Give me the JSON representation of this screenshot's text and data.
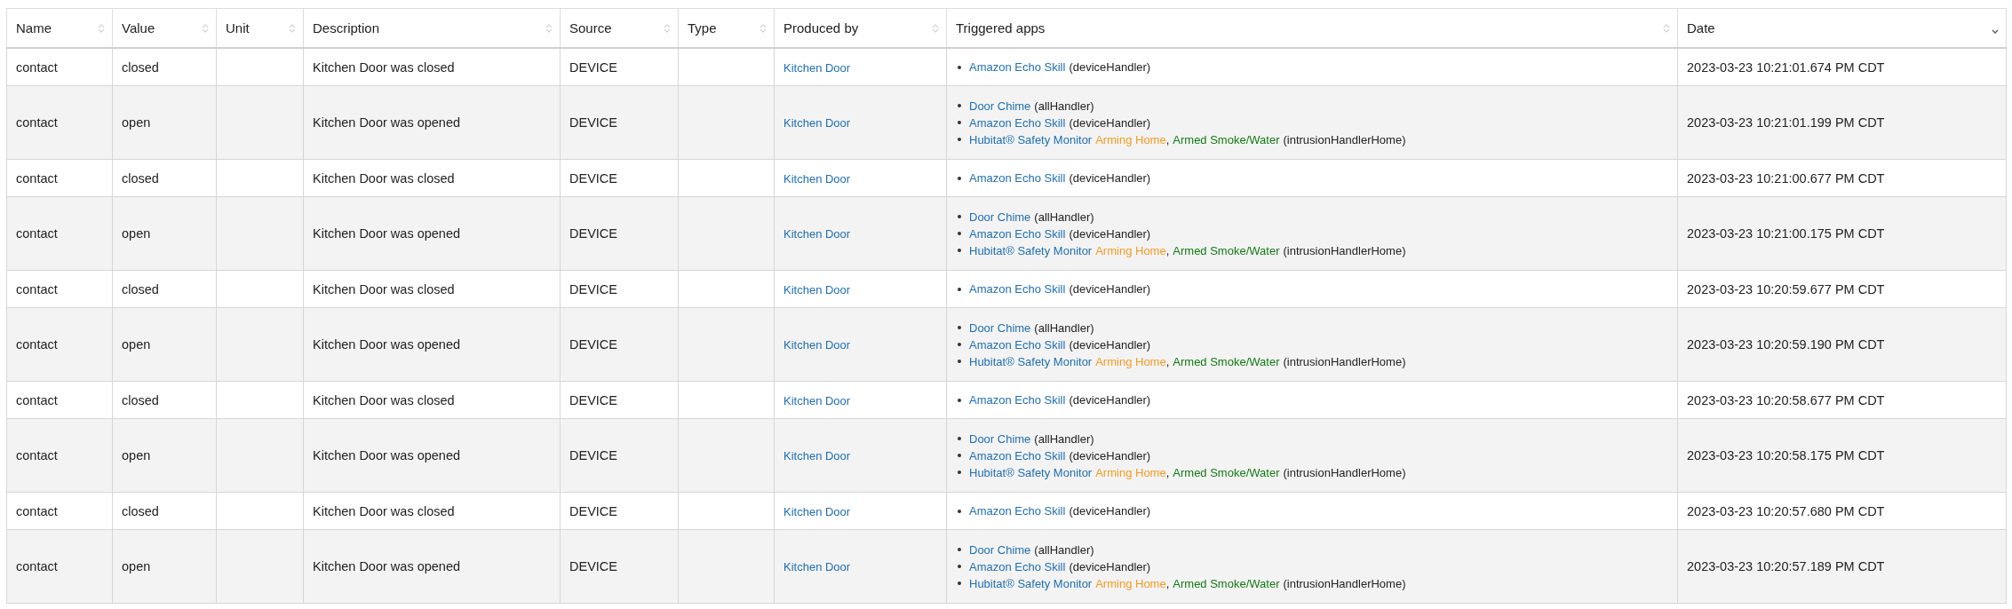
{
  "table": {
    "columns": [
      {
        "label": "Name",
        "sorted": false
      },
      {
        "label": "Value",
        "sorted": false
      },
      {
        "label": "Unit",
        "sorted": false
      },
      {
        "label": "Description",
        "sorted": false
      },
      {
        "label": "Source",
        "sorted": false
      },
      {
        "label": "Type",
        "sorted": false
      },
      {
        "label": "Produced by",
        "sorted": false
      },
      {
        "label": "Triggered apps",
        "sorted": false
      },
      {
        "label": "Date",
        "sorted": true
      }
    ],
    "rows": [
      {
        "name": "contact",
        "value": "closed",
        "description": "Kitchen Door was closed",
        "source": "DEVICE",
        "produced_by": "Kitchen Door",
        "triggered_apps": [
          [
            {
              "kind": "link",
              "text": "Amazon Echo Skill"
            },
            {
              "kind": "plain",
              "text": "(deviceHandler)"
            }
          ]
        ],
        "date": "2023-03-23 10:21:01.674 PM CDT"
      },
      {
        "name": "contact",
        "value": "open",
        "description": "Kitchen Door was opened",
        "source": "DEVICE",
        "produced_by": "Kitchen Door",
        "triggered_apps": [
          [
            {
              "kind": "link",
              "text": "Door Chime"
            },
            {
              "kind": "plain",
              "text": "(allHandler)"
            }
          ],
          [
            {
              "kind": "link",
              "text": "Amazon Echo Skill"
            },
            {
              "kind": "plain",
              "text": "(deviceHandler)"
            }
          ],
          [
            {
              "kind": "link",
              "text": "Hubitat® Safety Monitor"
            },
            {
              "kind": "mode",
              "text": "Arming Home",
              "color": "#f59b22"
            },
            {
              "kind": "sep",
              "text": ","
            },
            {
              "kind": "mode",
              "text": "Armed Smoke/Water",
              "color": "#137a13"
            },
            {
              "kind": "plain",
              "text": "(intrusionHandlerHome)"
            }
          ]
        ],
        "date": "2023-03-23 10:21:01.199 PM CDT"
      },
      {
        "name": "contact",
        "value": "closed",
        "description": "Kitchen Door was closed",
        "source": "DEVICE",
        "produced_by": "Kitchen Door",
        "triggered_apps": [
          [
            {
              "kind": "link",
              "text": "Amazon Echo Skill"
            },
            {
              "kind": "plain",
              "text": "(deviceHandler)"
            }
          ]
        ],
        "date": "2023-03-23 10:21:00.677 PM CDT"
      },
      {
        "name": "contact",
        "value": "open",
        "description": "Kitchen Door was opened",
        "source": "DEVICE",
        "produced_by": "Kitchen Door",
        "triggered_apps": [
          [
            {
              "kind": "link",
              "text": "Door Chime"
            },
            {
              "kind": "plain",
              "text": "(allHandler)"
            }
          ],
          [
            {
              "kind": "link",
              "text": "Amazon Echo Skill"
            },
            {
              "kind": "plain",
              "text": "(deviceHandler)"
            }
          ],
          [
            {
              "kind": "link",
              "text": "Hubitat® Safety Monitor"
            },
            {
              "kind": "mode",
              "text": "Arming Home",
              "color": "#f59b22"
            },
            {
              "kind": "sep",
              "text": ","
            },
            {
              "kind": "mode",
              "text": "Armed Smoke/Water",
              "color": "#137a13"
            },
            {
              "kind": "plain",
              "text": "(intrusionHandlerHome)"
            }
          ]
        ],
        "date": "2023-03-23 10:21:00.175 PM CDT"
      },
      {
        "name": "contact",
        "value": "closed",
        "description": "Kitchen Door was closed",
        "source": "DEVICE",
        "produced_by": "Kitchen Door",
        "triggered_apps": [
          [
            {
              "kind": "link",
              "text": "Amazon Echo Skill"
            },
            {
              "kind": "plain",
              "text": "(deviceHandler)"
            }
          ]
        ],
        "date": "2023-03-23 10:20:59.677 PM CDT"
      },
      {
        "name": "contact",
        "value": "open",
        "description": "Kitchen Door was opened",
        "source": "DEVICE",
        "produced_by": "Kitchen Door",
        "triggered_apps": [
          [
            {
              "kind": "link",
              "text": "Door Chime"
            },
            {
              "kind": "plain",
              "text": "(allHandler)"
            }
          ],
          [
            {
              "kind": "link",
              "text": "Amazon Echo Skill"
            },
            {
              "kind": "plain",
              "text": "(deviceHandler)"
            }
          ],
          [
            {
              "kind": "link",
              "text": "Hubitat® Safety Monitor"
            },
            {
              "kind": "mode",
              "text": "Arming Home",
              "color": "#f59b22"
            },
            {
              "kind": "sep",
              "text": ","
            },
            {
              "kind": "mode",
              "text": "Armed Smoke/Water",
              "color": "#137a13"
            },
            {
              "kind": "plain",
              "text": "(intrusionHandlerHome)"
            }
          ]
        ],
        "date": "2023-03-23 10:20:59.190 PM CDT"
      },
      {
        "name": "contact",
        "value": "closed",
        "description": "Kitchen Door was closed",
        "source": "DEVICE",
        "produced_by": "Kitchen Door",
        "triggered_apps": [
          [
            {
              "kind": "link",
              "text": "Amazon Echo Skill"
            },
            {
              "kind": "plain",
              "text": "(deviceHandler)"
            }
          ]
        ],
        "date": "2023-03-23 10:20:58.677 PM CDT"
      },
      {
        "name": "contact",
        "value": "open",
        "description": "Kitchen Door was opened",
        "source": "DEVICE",
        "produced_by": "Kitchen Door",
        "triggered_apps": [
          [
            {
              "kind": "link",
              "text": "Door Chime"
            },
            {
              "kind": "plain",
              "text": "(allHandler)"
            }
          ],
          [
            {
              "kind": "link",
              "text": "Amazon Echo Skill"
            },
            {
              "kind": "plain",
              "text": "(deviceHandler)"
            }
          ],
          [
            {
              "kind": "link",
              "text": "Hubitat® Safety Monitor"
            },
            {
              "kind": "mode",
              "text": "Arming Home",
              "color": "#f59b22"
            },
            {
              "kind": "sep",
              "text": ","
            },
            {
              "kind": "mode",
              "text": "Armed Smoke/Water",
              "color": "#137a13"
            },
            {
              "kind": "plain",
              "text": "(intrusionHandlerHome)"
            }
          ]
        ],
        "date": "2023-03-23 10:20:58.175 PM CDT"
      },
      {
        "name": "contact",
        "value": "closed",
        "description": "Kitchen Door was closed",
        "source": "DEVICE",
        "produced_by": "Kitchen Door",
        "triggered_apps": [
          [
            {
              "kind": "link",
              "text": "Amazon Echo Skill"
            },
            {
              "kind": "plain",
              "text": "(deviceHandler)"
            }
          ]
        ],
        "date": "2023-03-23 10:20:57.680 PM CDT"
      },
      {
        "name": "contact",
        "value": "open",
        "description": "Kitchen Door was opened",
        "source": "DEVICE",
        "produced_by": "Kitchen Door",
        "triggered_apps": [
          [
            {
              "kind": "link",
              "text": "Door Chime"
            },
            {
              "kind": "plain",
              "text": "(allHandler)"
            }
          ],
          [
            {
              "kind": "link",
              "text": "Amazon Echo Skill"
            },
            {
              "kind": "plain",
              "text": "(deviceHandler)"
            }
          ],
          [
            {
              "kind": "link",
              "text": "Hubitat® Safety Monitor"
            },
            {
              "kind": "mode",
              "text": "Arming Home",
              "color": "#f59b22"
            },
            {
              "kind": "sep",
              "text": ","
            },
            {
              "kind": "mode",
              "text": "Armed Smoke/Water",
              "color": "#137a13"
            },
            {
              "kind": "plain",
              "text": "(intrusionHandlerHome)"
            }
          ]
        ],
        "date": "2023-03-23 10:20:57.189 PM CDT"
      }
    ]
  }
}
